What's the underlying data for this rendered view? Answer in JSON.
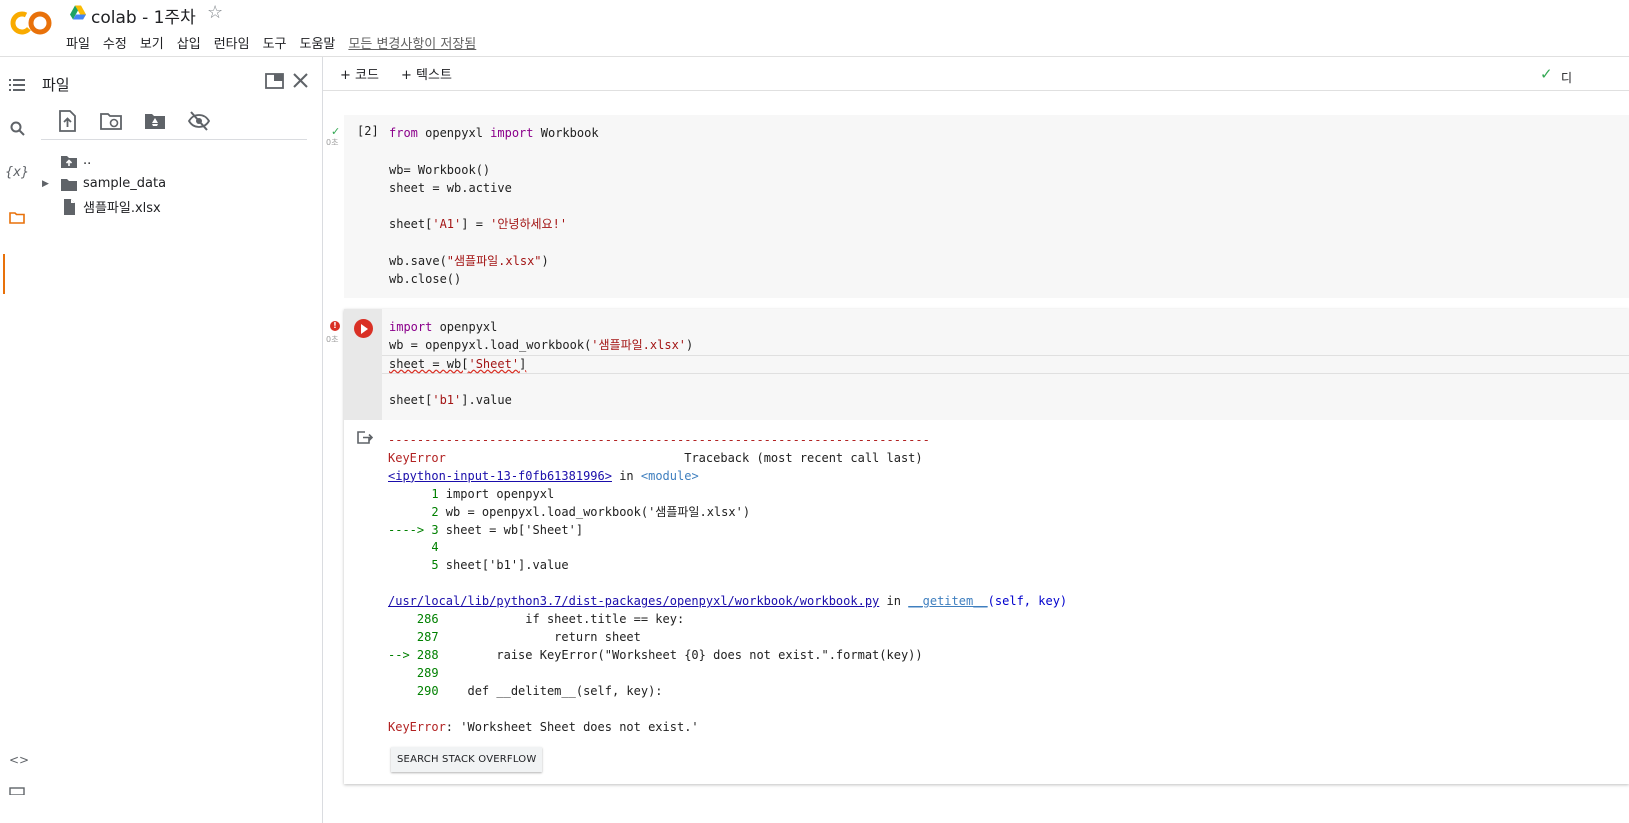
{
  "header": {
    "title": "colab - 1주차",
    "menu": [
      "파일",
      "수정",
      "보기",
      "삽입",
      "런타임",
      "도구",
      "도움말"
    ],
    "saved_status": "모든 변경사항이 저장됨"
  },
  "files_panel": {
    "title": "파일",
    "tree": [
      {
        "label": "..",
        "icon": "folder-up-icon"
      },
      {
        "label": "sample_data",
        "icon": "folder-icon"
      },
      {
        "label": "샘플파일.xlsx",
        "icon": "file-icon"
      }
    ]
  },
  "toolbar": {
    "add_code": "+ 코드",
    "add_text": "+ 텍스트",
    "connected_label": "디"
  },
  "cell1": {
    "exec_count": "[2]",
    "time": "0초",
    "lines": [
      "from openpyxl import Workbook",
      "",
      "wb= Workbook()",
      "sheet = wb.active",
      "",
      "sheet['A1'] = '안녕하세요!'",
      "",
      "wb.save(\"샘플파일.xlsx\")",
      "wb.close()"
    ]
  },
  "cell2": {
    "time": "0초",
    "lines": [
      "import openpyxl",
      "wb = openpyxl.load_workbook('샘플파일.xlsx')",
      "sheet = wb['Sheet']",
      "",
      "sheet['b1'].value"
    ],
    "output": {
      "separator": "---------------------------------------------------------------------------",
      "error_name": "KeyError",
      "traceback_header": "Traceback (most recent call last)",
      "input_link": "<ipython-input-13-f0fb61381996>",
      "in_word": " in ",
      "module": "<module>",
      "trace1": [
        {
          "prefix": "      1 ",
          "code": "import openpyxl"
        },
        {
          "prefix": "      2 ",
          "code": "wb = openpyxl.load_workbook('샘플파일.xlsx')"
        },
        {
          "prefix": "----> 3 ",
          "code": "sheet = wb['Sheet']"
        },
        {
          "prefix": "      4",
          "code": ""
        },
        {
          "prefix": "      5 ",
          "code": "sheet['b1'].value"
        }
      ],
      "file_link": "/usr/local/lib/python3.7/dist-packages/openpyxl/workbook/workbook.py",
      "func": "__getitem__",
      "func_args": "(self, key)",
      "trace2": [
        {
          "prefix": "    286 ",
          "code": "           if sheet.title == key:"
        },
        {
          "prefix": "    287 ",
          "code": "               return sheet"
        },
        {
          "prefix": "--> 288 ",
          "code": "       raise KeyError(\"Worksheet {0} does not exist.\".format(key))"
        },
        {
          "prefix": "    289",
          "code": ""
        },
        {
          "prefix": "    290 ",
          "code": "   def __delitem__(self, key):"
        }
      ],
      "final_error": "KeyError",
      "final_message": ": 'Worksheet Sheet does not exist.'",
      "so_button": "SEARCH STACK OVERFLOW"
    }
  },
  "colors": {
    "accent_orange": "#e8710a",
    "error_red": "#d93025",
    "success_green": "#34a853"
  }
}
